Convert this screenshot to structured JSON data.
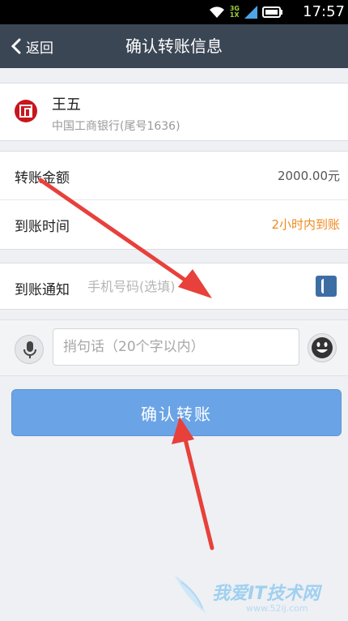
{
  "status_bar": {
    "time": "17:57",
    "network_top": "3G",
    "network_bottom": "1X"
  },
  "header": {
    "back_label": "返回",
    "title": "确认转账信息"
  },
  "payee": {
    "name": "王五",
    "bank": "中国工商银行(尾号1636)"
  },
  "transfer": {
    "amount_label": "转账金额",
    "amount_value": "2000.00元",
    "arrival_label": "到账时间",
    "arrival_value": "2小时内到账"
  },
  "notify": {
    "label": "到账通知",
    "placeholder": "手机号码(选填)"
  },
  "message": {
    "placeholder": "捎句话（20个字以内）"
  },
  "confirm_label": "确认转账",
  "watermark": {
    "text": "我爱IT技术网",
    "url": "www.52ij.com"
  },
  "colors": {
    "header_bg": "#3b4655",
    "accent_blue": "#6aa4e6",
    "arrival_orange": "#ef8a1f",
    "annotation_red": "#e8403a"
  },
  "icons": {
    "back": "chevron-left-icon",
    "bank": "icbc-logo",
    "contact": "contact-book-icon",
    "mic": "microphone-icon",
    "emoji": "smiley-icon"
  }
}
